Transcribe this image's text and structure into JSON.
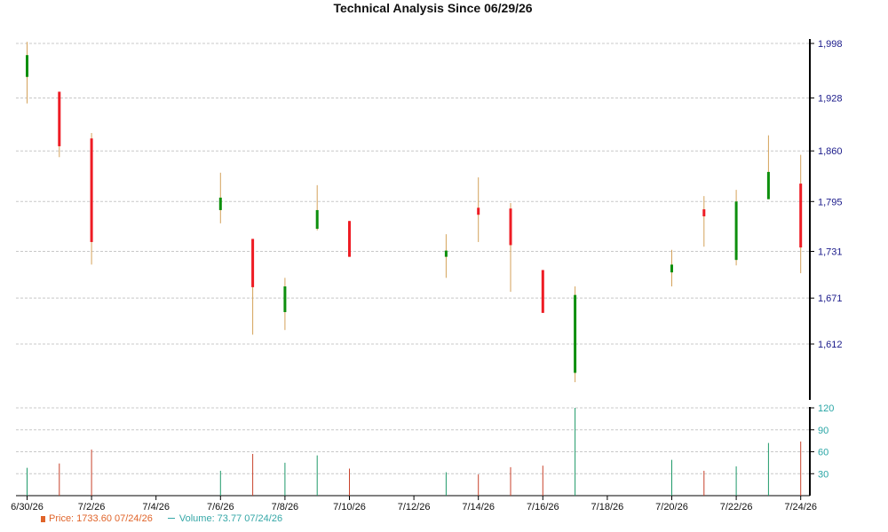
{
  "chart_data": {
    "type": "candlestick",
    "title": "Technical Analysis Since 06/29/26",
    "price_axis": {
      "ticks": [
        "1,998",
        "1,928",
        "1,860",
        "1,795",
        "1,731",
        "1,671",
        "1,612"
      ]
    },
    "volume_axis": {
      "ticks": [
        "120",
        "90",
        "60",
        "30"
      ]
    },
    "x_ticks": [
      "6/30/26",
      "7/2/26",
      "7/4/26",
      "7/6/26",
      "7/8/26",
      "7/10/26",
      "7/12/26",
      "7/14/26",
      "7/16/26",
      "7/18/26",
      "7/20/26",
      "7/22/26",
      "7/24/26"
    ],
    "grid": true,
    "candles": [
      {
        "date": "6/30/26",
        "open": 1955,
        "high": 2000,
        "low": 1921,
        "close": 1983,
        "volume": 38
      },
      {
        "date": "7/1/26",
        "open": 1936,
        "high": 1936,
        "low": 1852,
        "close": 1866,
        "volume": 44
      },
      {
        "date": "7/2/26",
        "open": 1876,
        "high": 1883,
        "low": 1714,
        "close": 1743,
        "volume": 63
      },
      {
        "date": "7/6/26",
        "open": 1784,
        "high": 1832,
        "low": 1767,
        "close": 1800,
        "volume": 34
      },
      {
        "date": "7/7/26",
        "open": 1747,
        "high": 1747,
        "low": 1624,
        "close": 1685,
        "volume": 57
      },
      {
        "date": "7/8/26",
        "open": 1653,
        "high": 1697,
        "low": 1630,
        "close": 1686,
        "volume": 45
      },
      {
        "date": "7/9/26",
        "open": 1760,
        "high": 1816,
        "low": 1758,
        "close": 1784,
        "volume": 55
      },
      {
        "date": "7/10/26",
        "open": 1770,
        "high": 1770,
        "low": 1724,
        "close": 1724,
        "volume": 37
      },
      {
        "date": "7/13/26",
        "open": 1724,
        "high": 1753,
        "low": 1697,
        "close": 1732,
        "volume": 32
      },
      {
        "date": "7/14/26",
        "open": 1787,
        "high": 1826,
        "low": 1743,
        "close": 1778,
        "volume": 29
      },
      {
        "date": "7/15/26",
        "open": 1786,
        "high": 1793,
        "low": 1679,
        "close": 1739,
        "volume": 39
      },
      {
        "date": "7/16/26",
        "open": 1707,
        "high": 1707,
        "low": 1652,
        "close": 1652,
        "volume": 41
      },
      {
        "date": "7/17/26",
        "open": 1575,
        "high": 1686,
        "low": 1563,
        "close": 1675,
        "volume": 120
      },
      {
        "date": "7/20/26",
        "open": 1704,
        "high": 1733,
        "low": 1686,
        "close": 1714,
        "volume": 49
      },
      {
        "date": "7/21/26",
        "open": 1785,
        "high": 1802,
        "low": 1737,
        "close": 1776,
        "volume": 34
      },
      {
        "date": "7/22/26",
        "open": 1720,
        "high": 1810,
        "low": 1713,
        "close": 1795,
        "volume": 40
      },
      {
        "date": "7/23/26",
        "open": 1798,
        "high": 1880,
        "low": 1798,
        "close": 1833,
        "volume": 72
      },
      {
        "date": "7/24/26",
        "open": 1818,
        "high": 1855,
        "low": 1703,
        "close": 1736,
        "volume": 74
      }
    ],
    "colors": {
      "up": "#0d8f0d",
      "down": "#ee1c24",
      "wick": "#d4a25a",
      "vol_up": "#1f9a6a",
      "vol_down": "#c8422b",
      "axis_text": "#1a1a8a",
      "vol_axis_text": "#2aa6a6",
      "grid": "#c8c8c8"
    }
  },
  "legend": {
    "price_label": "Price: 1733.60  07/24/26",
    "volume_label": "Volume: 73.77  07/24/26",
    "price_color": "#e0642a",
    "volume_color": "#35a7a7"
  }
}
